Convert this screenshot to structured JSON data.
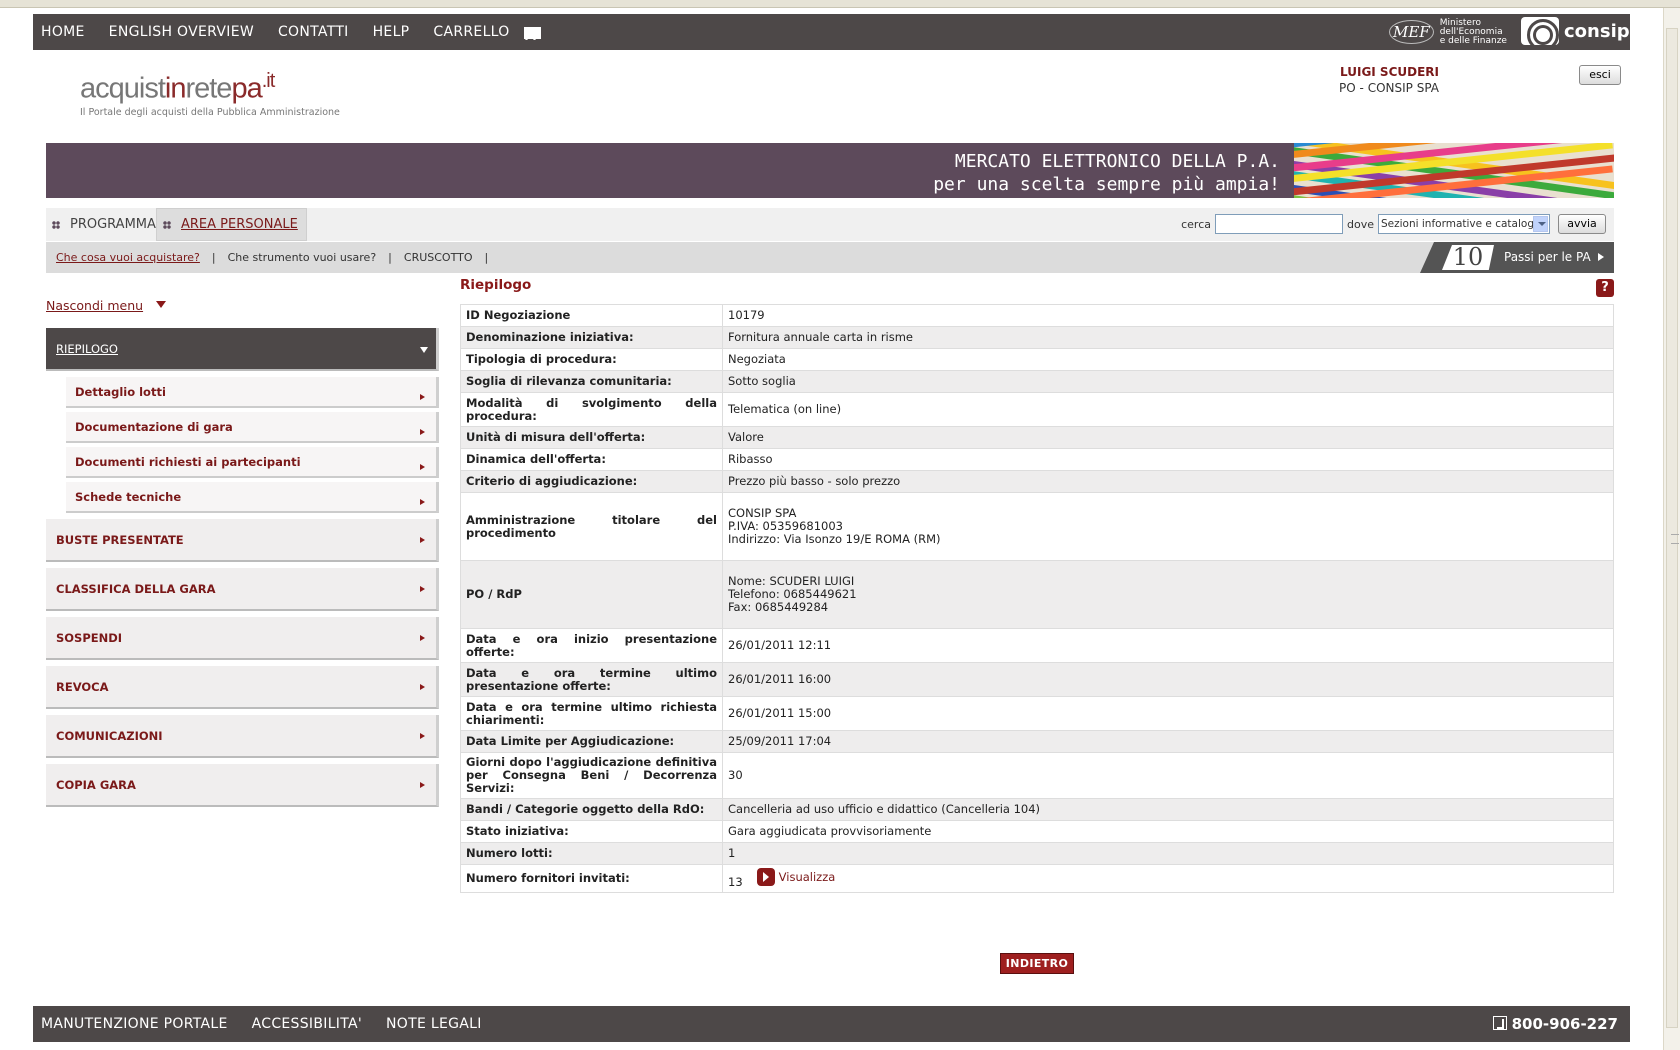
{
  "topnav": {
    "items": [
      "HOME",
      "ENGLISH OVERVIEW",
      "CONTATTI",
      "HELP",
      "CARRELLO"
    ],
    "mef_logo": "MEF",
    "mef_lines": [
      "Ministero",
      "dell'Economia",
      "e delle Finanze"
    ],
    "consip": "consip"
  },
  "brand": {
    "logo_prefix": "acquist",
    "logo_in": "in",
    "logo_rete": "rete",
    "logo_pa": "pa",
    "logo_it": ".it",
    "tagline": "Il Portale degli acquisti della Pubblica Amministrazione"
  },
  "user": {
    "name": "LUIGI SCUDERI",
    "org": "PO - CONSIP SPA",
    "logout_label": "esci"
  },
  "banner": {
    "line1": "MERCATO ELETTRONICO DELLA P.A.",
    "line2": "per una scelta sempre più ampia!"
  },
  "tabs": {
    "programma": "PROGRAMMA",
    "area": "AREA PERSONALE"
  },
  "search": {
    "label": "cerca",
    "value": "",
    "where_label": "dove",
    "where_value": "Sezioni informative e catalogo",
    "button": "avvia"
  },
  "sublinks": [
    "Che cosa vuoi acquistare?",
    "Che strumento vuoi usare?",
    "CRUSCOTTO"
  ],
  "sep": "|",
  "passi": {
    "number": "10",
    "label": "Passi per le PA"
  },
  "sidebar": {
    "toggle": "Nascondi menu",
    "open_item": "RIEPILOGO",
    "sub_items": [
      "Dettaglio lotti",
      "Documentazione di gara",
      "Documenti richiesti ai partecipanti",
      "Schede tecniche"
    ],
    "items": [
      "BUSTE PRESENTATE",
      "CLASSIFICA DELLA GARA",
      "SOSPENDI",
      "REVOCA",
      "COMUNICAZIONI",
      "COPIA GARA"
    ]
  },
  "content": {
    "title": "Riepilogo",
    "help": "?",
    "rows": [
      {
        "k": "ID Negoziazione",
        "v": "10179"
      },
      {
        "k": "Denominazione iniziativa:",
        "v": "Fornitura annuale carta in risme"
      },
      {
        "k": "Tipologia di procedura:",
        "v": "Negoziata"
      },
      {
        "k": "Soglia di rilevanza comunitaria:",
        "v": "Sotto soglia"
      },
      {
        "k": "Modalità di svolgimento della procedura:",
        "v": "Telematica (on line)"
      },
      {
        "k": "Unità di misura dell'offerta:",
        "v": "Valore"
      },
      {
        "k": "Dinamica dell'offerta:",
        "v": "Ribasso"
      },
      {
        "k": "Criterio di aggiudicazione:",
        "v": "Prezzo più basso - solo prezzo"
      },
      {
        "k": "Amministrazione titolare del procedimento",
        "v": "CONSIP SPA\nP.IVA: 05359681003\nIndirizzo: Via Isonzo 19/E ROMA (RM)"
      },
      {
        "k": "PO / RdP",
        "v": "Nome: SCUDERI LUIGI\nTelefono: 0685449621\nFax: 0685449284"
      },
      {
        "k": "Data e ora inizio presentazione offerte:",
        "v": "26/01/2011 12:11"
      },
      {
        "k": "Data e ora termine ultimo presentazione offerte:",
        "v": "26/01/2011 16:00"
      },
      {
        "k": "Data e ora termine ultimo richiesta chiarimenti:",
        "v": "26/01/2011 15:00"
      },
      {
        "k": "Data Limite per Aggiudicazione:",
        "v": "25/09/2011 17:04"
      },
      {
        "k": "Giorni dopo l'aggiudicazione definitiva per Consegna Beni / Decorrenza Servizi:",
        "v": "30"
      },
      {
        "k": "Bandi / Categorie oggetto della RdO:",
        "v": "Cancelleria ad uso ufficio e didattico (Cancelleria 104)"
      },
      {
        "k": "Stato iniziativa:",
        "v": "Gara aggiudicata provvisoriamente"
      },
      {
        "k": "Numero lotti:",
        "v": "1"
      },
      {
        "k": "Numero fornitori invitati:",
        "v": "13"
      }
    ],
    "view_link": "Visualizza",
    "back_button": "INDIETRO"
  },
  "footer": {
    "items": [
      "MANUTENZIONE PORTALE",
      "ACCESSIBILITA'",
      "NOTE LEGALI"
    ],
    "phone": "800-906-227"
  },
  "colors": {
    "accent": "#8a1919",
    "bar": "#4d4848",
    "banner": "#5d4a5b"
  }
}
